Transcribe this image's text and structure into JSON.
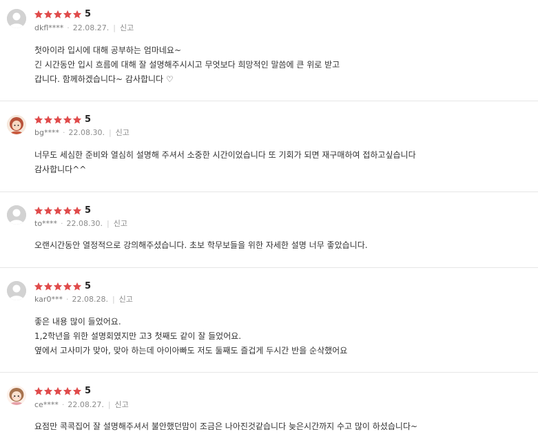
{
  "colors": {
    "star": "#e04b4b",
    "divider": "#e6e6e6"
  },
  "reviews": [
    {
      "score": "5",
      "user": "dkfl****",
      "date": "22.08.27.",
      "report": "신고",
      "lines": [
        "첫아이라 입시에 대해 공부하는 엄마네요~",
        "긴 시간동안 입시 흐름에 대해 잘 설명해주시시고 무엇보다 희망적인 말씀에 큰 위로 받고",
        "갑니다. 함께하겠습니다~ 감사합니다 ♡"
      ]
    },
    {
      "score": "5",
      "user": "bg****",
      "date": "22.08.30.",
      "report": "신고",
      "lines": [
        "너무도 세심한 준비와 열심히 설명해 주셔서 소중한 시간이었습니다  또 기회가 되면  재구매하여  접하고싶습니다",
        "감사합니다^^"
      ]
    },
    {
      "score": "5",
      "user": "to****",
      "date": "22.08.30.",
      "report": "신고",
      "lines": [
        "오랜시간동안 열정적으로 강의해주셨습니다. 초보 학무보들을 위한 자세한 설명 너무 좋았습니다."
      ]
    },
    {
      "score": "5",
      "user": "kar0***",
      "date": "22.08.28.",
      "report": "신고",
      "lines": [
        "좋은 내용 많이 들었어요.",
        "1,2학년을 위한 설명회였지만 고3  첫째도 같이 잘 들었어요.",
        "옆에서 고사미가 맞아, 맞아 하는데 아이아빠도 저도 둘째도 즐겁게 두시간 반을 순삭했어요"
      ]
    },
    {
      "score": "5",
      "user": "ce****",
      "date": "22.08.27.",
      "report": "신고",
      "lines": [
        "요점만 콕콕집어 잘 설명해주셔서 불안했던맘이  조금은 나아진것같습니다 늦은시간까지 수고 많이 하셨습니다~"
      ]
    }
  ]
}
